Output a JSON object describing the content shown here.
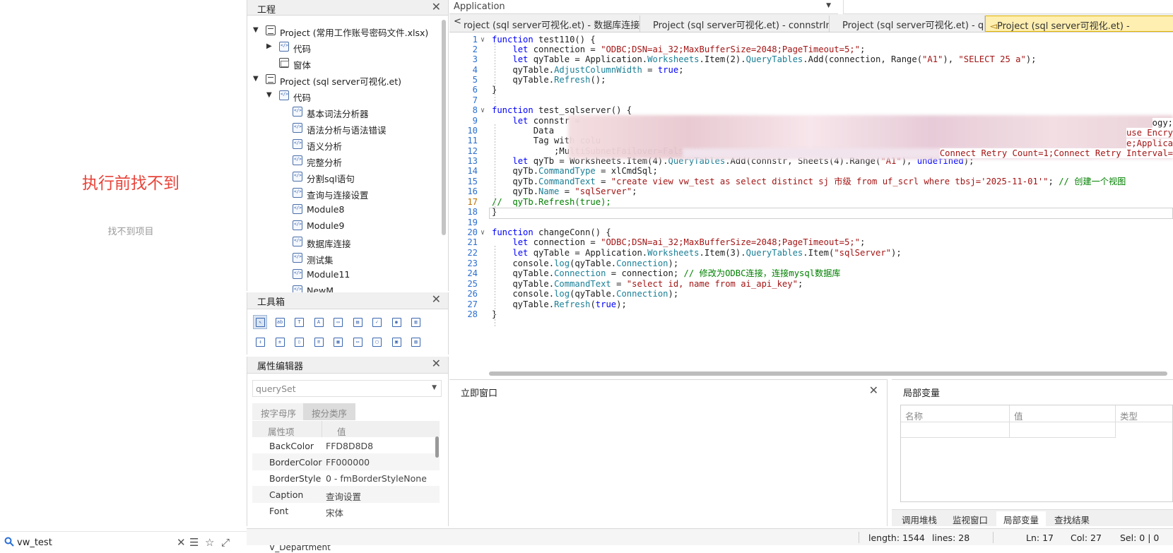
{
  "left_panel": {
    "message": "执行前找不到",
    "submessage": "找不到项目",
    "search_value": "vw_test"
  },
  "project_pane": {
    "title": "工程",
    "items": [
      {
        "label": "Project (常用工作账号密码文件.xlsx)",
        "icon": "project-icon"
      },
      {
        "label": "代码",
        "icon": "code-icon"
      },
      {
        "label": "窗体",
        "icon": "form-icon"
      },
      {
        "label": "Project (sql server可视化.et)",
        "icon": "project-icon"
      },
      {
        "label": "代码",
        "icon": "code-icon"
      },
      {
        "label": "基本词法分析器",
        "icon": "code-icon"
      },
      {
        "label": "语法分析与语法错误",
        "icon": "code-icon"
      },
      {
        "label": "语义分析",
        "icon": "code-icon"
      },
      {
        "label": "完整分析",
        "icon": "code-icon"
      },
      {
        "label": "分割sql语句",
        "icon": "code-icon"
      },
      {
        "label": "查询与连接设置",
        "icon": "code-icon"
      },
      {
        "label": "Module8",
        "icon": "code-icon"
      },
      {
        "label": "Module9",
        "icon": "code-icon"
      },
      {
        "label": "数据库连接",
        "icon": "code-icon"
      },
      {
        "label": "测试集",
        "icon": "code-icon"
      },
      {
        "label": "Module11",
        "icon": "code-icon"
      },
      {
        "label": "NewM...",
        "icon": "code-icon"
      }
    ]
  },
  "toolbox": {
    "title": "工具箱",
    "tools": [
      "pointer-icon",
      "button-icon",
      "label-icon",
      "textbox-icon",
      "frame-icon",
      "combobox-icon",
      "checkbox-icon",
      "radio-icon",
      "listbox-icon",
      "spin-icon",
      "scrollbar-icon",
      "hscroll-icon",
      "vlist-icon",
      "multipage-icon",
      "tabstrip-icon",
      "image-icon",
      "refedit-icon",
      "grid-icon"
    ]
  },
  "properties": {
    "title": "属性编辑器",
    "object": "querySet",
    "tab_alpha": "按字母序",
    "tab_category": "按分类序",
    "col_name": "属性项",
    "col_value": "值",
    "rows": [
      {
        "key": "BackColor",
        "value": "FFD8D8D8"
      },
      {
        "key": "BorderColor",
        "value": "FF000000"
      },
      {
        "key": "BorderStyle",
        "value": "0 - fmBorderStyleNone"
      },
      {
        "key": "Caption",
        "value": "查询设置"
      },
      {
        "key": "Font",
        "value": "宋体"
      }
    ]
  },
  "top": {
    "app_select": "Application"
  },
  "tabs": [
    {
      "label": "roject (sql server可视化.et) - 数据库连接测试"
    },
    {
      "label": "Project (sql server可视化.et) - connstrInput"
    },
    {
      "label": "Project (sql server可视化.et) - querySet"
    },
    {
      "label": "Project (sql server可视化.et) -"
    }
  ],
  "code_lines": [
    {
      "n": "1",
      "t": "function test110() {"
    },
    {
      "n": "2",
      "t": "    let connection = \"ODBC;DSN=ai_32;MaxBufferSize=2048;PageTimeout=5;\";"
    },
    {
      "n": "3",
      "t": "    let qyTable = Application.Worksheets.Item(2).QueryTables.Add(connection, Range(\"A1\"), \"SELECT 25 a\");"
    },
    {
      "n": "4",
      "t": "    qyTable.AdjustColumnWidth = true;"
    },
    {
      "n": "5",
      "t": "    qyTable.Refresh();"
    },
    {
      "n": "6",
      "t": "}"
    },
    {
      "n": "7",
      "t": ""
    },
    {
      "n": "8",
      "t": "function test_sqlserver() {"
    },
    {
      "n": "9",
      "t": "    let connstr ="
    },
    {
      "n": "10",
      "t": "        Data"
    },
    {
      "n": "11",
      "t": "        Tag with colu"
    },
    {
      "n": "12",
      "t": "            ;MultiSubnetFailover=False;Use"
    },
    {
      "n": "13",
      "t": "    let qyTb = Worksheets.Item(4).QueryTables.Add(connstr, Sheets(4).Range(\"A1\"), undefined);"
    },
    {
      "n": "14",
      "t": "    qyTb.CommandType = xlCmdSql;"
    },
    {
      "n": "15",
      "t": "    qyTb.CommandText = \"create view vw_test as select distinct sj 市级 from uf_scrl where tbsj='2025-11-01'\"; // 创建一个视图"
    },
    {
      "n": "16",
      "t": "    qyTb.Name = \"sqlServer\";"
    },
    {
      "n": "17",
      "t": "//  qyTb.Refresh(true);"
    },
    {
      "n": "18",
      "t": "}"
    },
    {
      "n": "19",
      "t": ""
    },
    {
      "n": "20",
      "t": "function changeConn() {"
    },
    {
      "n": "21",
      "t": "    let connection = \"ODBC;DSN=ai_32;MaxBufferSize=2048;PageTimeout=5;\";"
    },
    {
      "n": "22",
      "t": "    let qyTable = Application.Worksheets.Item(3).QueryTables.Item(\"sqlServer\");"
    },
    {
      "n": "23",
      "t": "    console.log(qyTable.Connection);"
    },
    {
      "n": "24",
      "t": "    qyTable.Connection = connection; // 修改为ODBC连接，连接mysql数据库"
    },
    {
      "n": "25",
      "t": "    qyTable.CommandText = \"select id, name from ai_api_key\";"
    },
    {
      "n": "26",
      "t": "    console.log(qyTable.Connection);"
    },
    {
      "n": "27",
      "t": "    qyTable.Refresh(true);"
    },
    {
      "n": "28",
      "t": "}"
    }
  ],
  "code_tail": {
    "l9": "ogy;",
    "l10": "use Encry",
    "l11": "e;Applica",
    "l12": "Connect Retry Count=1;Connect Retry Interval="
  },
  "immediate": {
    "title": "立即窗口"
  },
  "locals": {
    "title": "局部变量",
    "cols": [
      "名称",
      "值",
      "类型"
    ],
    "tabs": [
      "调用堆栈",
      "监视窗口",
      "局部变量",
      "查找结果"
    ]
  },
  "status": {
    "length": "length: 1544",
    "lines": "lines: 28",
    "ln": "Ln: 17",
    "col": "Col: 27",
    "sel": "Sel: 0 | 0"
  },
  "bottom_strip": {
    "text": "V_Department"
  },
  "colors": {
    "keyword": "#0000ff",
    "string": "#a31515",
    "comment": "#008000",
    "property": "#1a7f96",
    "line_number": "#2b6fd0",
    "active_tab": "#ffefb0",
    "error_text": "#e8443a"
  }
}
